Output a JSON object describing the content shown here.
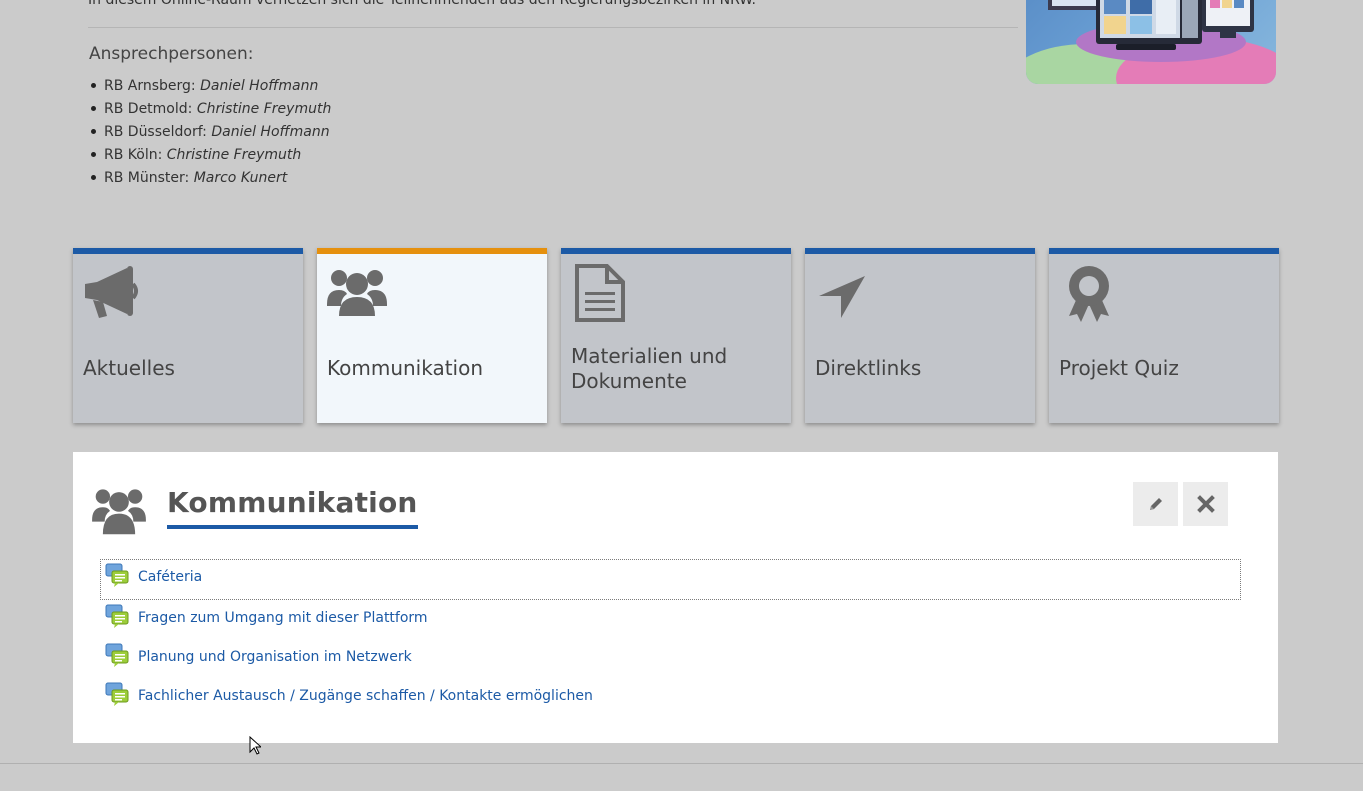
{
  "intro": {
    "text": "In diesem Online-Raum vernetzen sich die Teilnehmenden aus den Regierungsbezirken in NRW."
  },
  "contacts": {
    "heading": "Ansprechpersonen:",
    "items": [
      {
        "region": "RB Arnsberg:",
        "person": "Daniel Hoffmann"
      },
      {
        "region": "RB Detmold:",
        "person": "Christine Freymuth"
      },
      {
        "region": "RB Düsseldorf:",
        "person": "Daniel Hoffmann"
      },
      {
        "region": "RB Köln:",
        "person": "Christine Freymuth"
      },
      {
        "region": "RB Münster:",
        "person": "Marco Kunert"
      }
    ]
  },
  "tiles": [
    {
      "label": "Aktuelles",
      "icon": "megaphone-icon",
      "active": false
    },
    {
      "label": "Kommunikation",
      "icon": "users-icon",
      "active": true
    },
    {
      "label": "Materialien und Dokumente",
      "icon": "document-icon",
      "active": false
    },
    {
      "label": "Direktlinks",
      "icon": "location-arrow-icon",
      "active": false
    },
    {
      "label": "Projekt Quiz",
      "icon": "award-icon",
      "active": false
    }
  ],
  "panel": {
    "title": "Kommunikation",
    "edit_icon": "pencil-icon",
    "close_icon": "close-icon",
    "forums": [
      {
        "label": "Caféteria"
      },
      {
        "label": "Fragen zum Umgang mit dieser Plattform"
      },
      {
        "label": "Planung und Organisation im Netzwerk"
      },
      {
        "label": "Fachlicher Austausch / Zugänge schaffen / Kontakte ermöglichen"
      }
    ]
  },
  "colors": {
    "accent_blue": "#1c5aa6",
    "active_orange": "#e5900e",
    "tile_bg": "#c2c5ca",
    "tile_active_bg": "#f2f7fb",
    "page_bg": "#cbcbcb"
  }
}
